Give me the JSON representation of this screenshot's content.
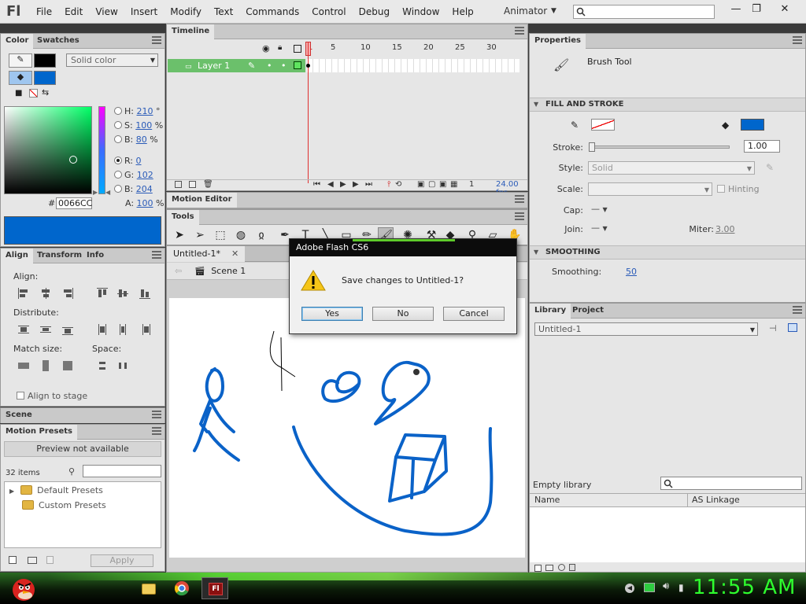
{
  "app": {
    "logo": "Fl"
  },
  "menu": [
    "File",
    "Edit",
    "View",
    "Insert",
    "Modify",
    "Text",
    "Commands",
    "Control",
    "Debug",
    "Window",
    "Help"
  ],
  "workspace": "Animator",
  "color_panel": {
    "tabs": [
      "Color",
      "Swatches"
    ],
    "fill_type": "Solid color",
    "hsb": [
      {
        "label": "H:",
        "value": "210",
        "unit": "°"
      },
      {
        "label": "S:",
        "value": "100",
        "unit": "%"
      },
      {
        "label": "B:",
        "value": "80",
        "unit": "%"
      }
    ],
    "rgb": [
      {
        "label": "R:",
        "value": "0"
      },
      {
        "label": "G:",
        "value": "102"
      },
      {
        "label": "B:",
        "value": "204"
      }
    ],
    "alpha_label": "A:",
    "alpha_value": "100",
    "alpha_unit": "%",
    "hex_label": "#",
    "hex_value": "0066CC",
    "current_color": "#0066cc"
  },
  "align_panel": {
    "tabs": [
      "Align",
      "Transform",
      "Info"
    ],
    "align_label": "Align:",
    "distribute_label": "Distribute:",
    "match_size_label": "Match size:",
    "space_label": "Space:",
    "align_to_stage": "Align to stage"
  },
  "scene_panel": {
    "tab": "Scene"
  },
  "presets_panel": {
    "tab": "Motion Presets",
    "preview": "Preview not available",
    "count": "32 items",
    "items": [
      "Default Presets",
      "Custom Presets"
    ],
    "apply": "Apply"
  },
  "timeline": {
    "tab": "Timeline",
    "layer": "Layer 1",
    "ruler": [
      "1",
      "5",
      "10",
      "15",
      "20",
      "25",
      "30"
    ],
    "current_frame": "1",
    "fps": "24.00 fps"
  },
  "motion_editor": {
    "tab": "Motion Editor"
  },
  "tools": {
    "tab": "Tools"
  },
  "document": {
    "tab": "Untitled-1*",
    "scene": "Scene 1"
  },
  "dialog": {
    "title": "Adobe Flash CS6",
    "message": "Save changes to Untitled-1?",
    "yes": "Yes",
    "no": "No",
    "cancel": "Cancel"
  },
  "properties": {
    "tab": "Properties",
    "tool_name": "Brush Tool",
    "fill_stroke_header": "FILL AND STROKE",
    "stroke_label": "Stroke:",
    "stroke_value": "1.00",
    "style_label": "Style:",
    "style_value": "Solid",
    "scale_label": "Scale:",
    "hinting_label": "Hinting",
    "cap_label": "Cap:",
    "join_label": "Join:",
    "miter_label": "Miter:",
    "miter_value": "3.00",
    "smoothing_header": "SMOOTHING",
    "smoothing_label": "Smoothing:",
    "smoothing_value": "50"
  },
  "library": {
    "tabs": [
      "Library",
      "Project"
    ],
    "document": "Untitled-1",
    "empty": "Empty library",
    "col_name": "Name",
    "col_linkage": "AS Linkage"
  },
  "taskbar": {
    "clock": "11:55 AM"
  }
}
